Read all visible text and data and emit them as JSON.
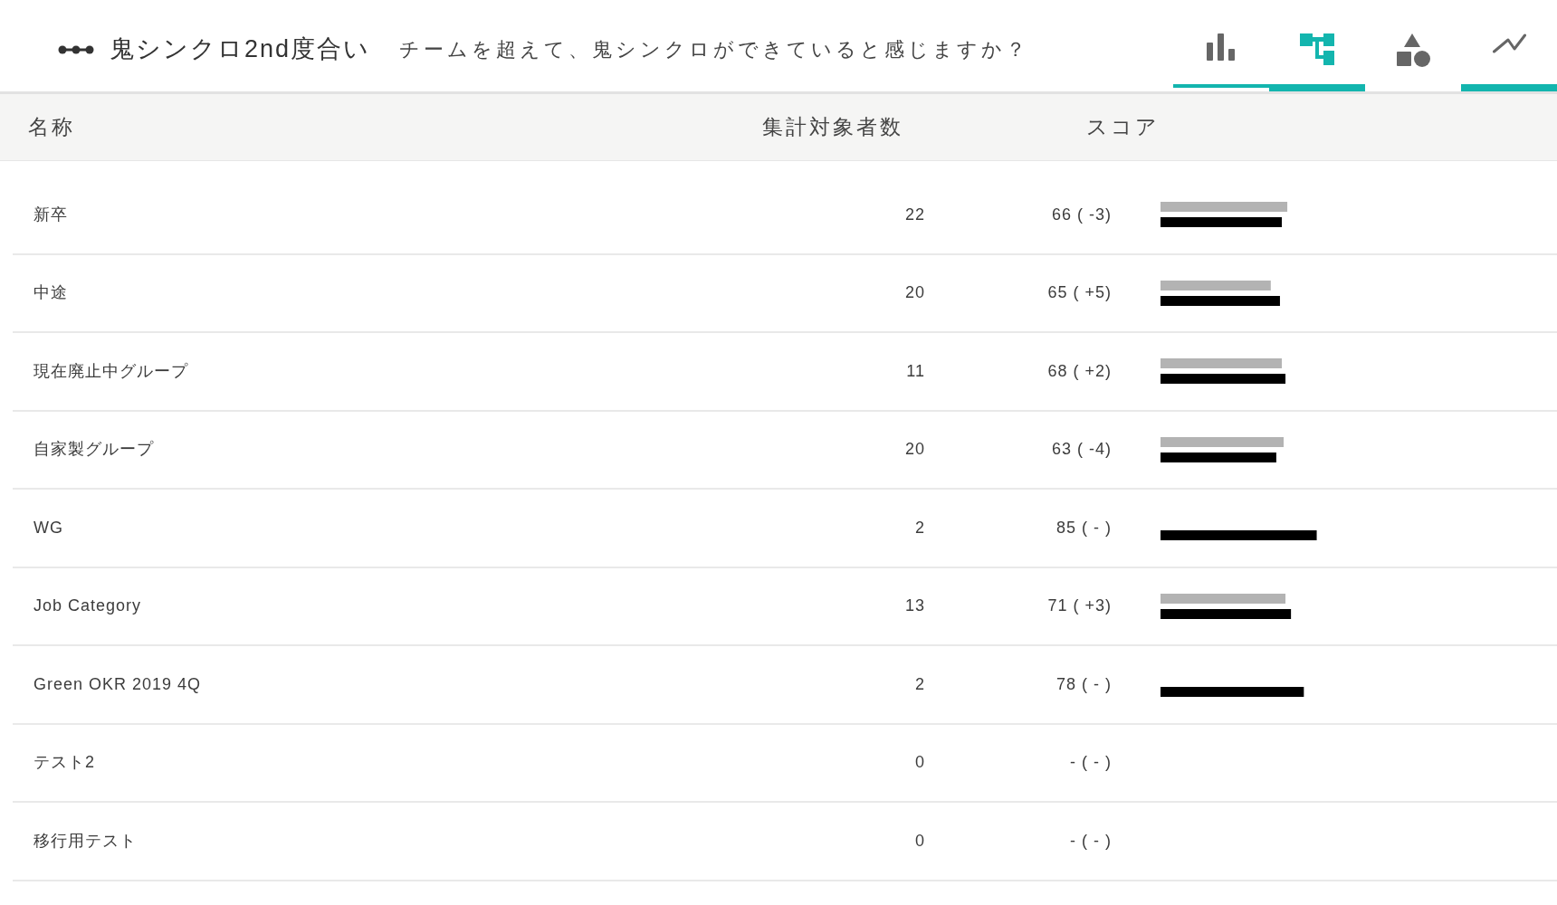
{
  "header": {
    "title": "鬼シンクロ2nd度合い",
    "question": "チームを超えて、鬼シンクロができていると感じますか？"
  },
  "view_tabs": [
    {
      "selected": false,
      "underlined": true,
      "underline_bold": false
    },
    {
      "selected": true,
      "underlined": true,
      "underline_bold": true
    },
    {
      "selected": false,
      "underlined": false,
      "underline_bold": false
    },
    {
      "selected": false,
      "underlined": true,
      "underline_bold": true
    }
  ],
  "table": {
    "columns": [
      "名称",
      "集計対象者数",
      "スコア"
    ],
    "rows": [
      {
        "name": "新卒",
        "count": "22",
        "score": "66 ( -3)",
        "bars": [
          {
            "kind": "previous",
            "level": 0.69
          },
          {
            "kind": "current",
            "level": 0.66
          }
        ]
      },
      {
        "name": "中途",
        "count": "20",
        "score": "65 ( +5)",
        "bars": [
          {
            "kind": "previous",
            "level": 0.6
          },
          {
            "kind": "current",
            "level": 0.65
          }
        ]
      },
      {
        "name": "現在廃止中グループ",
        "count": "11",
        "score": "68 ( +2)",
        "bars": [
          {
            "kind": "previous",
            "level": 0.66
          },
          {
            "kind": "current",
            "level": 0.68
          }
        ]
      },
      {
        "name": "自家製グループ",
        "count": "20",
        "score": "63 ( -4)",
        "bars": [
          {
            "kind": "previous",
            "level": 0.67
          },
          {
            "kind": "current",
            "level": 0.63
          }
        ]
      },
      {
        "name": "WG",
        "count": "2",
        "score": "85 ( - )",
        "bars": [
          {
            "kind": "current",
            "level": 0.85
          }
        ]
      },
      {
        "name": "Job Category",
        "count": "13",
        "score": "71 ( +3)",
        "bars": [
          {
            "kind": "previous",
            "level": 0.68
          },
          {
            "kind": "current",
            "level": 0.71
          }
        ]
      },
      {
        "name": "Green OKR 2019 4Q",
        "count": "2",
        "score": "78 ( - )",
        "bars": [
          {
            "kind": "current",
            "level": 0.78
          }
        ]
      },
      {
        "name": "テスト2",
        "count": "0",
        "score": "- ( - )"
      },
      {
        "name": "移行用テスト",
        "count": "0",
        "score": "- ( - )"
      }
    ]
  }
}
